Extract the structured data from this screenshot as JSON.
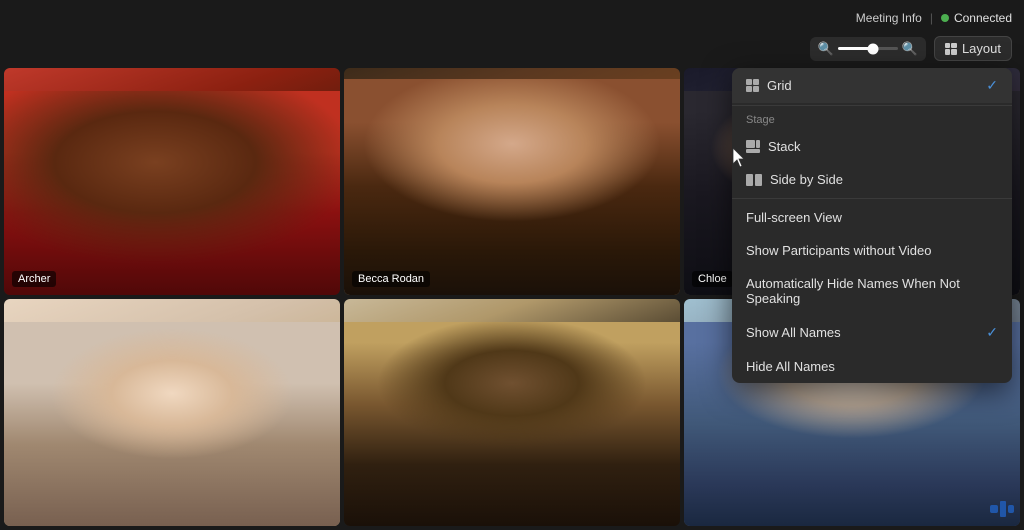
{
  "topbar": {
    "meeting_info_label": "Meeting Info",
    "separator": "|",
    "connected_label": "Connected"
  },
  "controls": {
    "zoom_minus": "⊖",
    "zoom_plus": "⊕",
    "layout_label": "Layout"
  },
  "dropdown": {
    "grid_label": "Grid",
    "stage_section": "Stage",
    "stack_label": "Stack",
    "side_by_side_label": "Side by Side",
    "fullscreen_label": "Full-screen View",
    "show_no_video_label": "Show Participants without Video",
    "auto_hide_names_label": "Automatically Hide Names When Not Speaking",
    "show_all_names_label": "Show All Names",
    "hide_all_names_label": "Hide All Names"
  },
  "participants": [
    {
      "name": "Archer",
      "position": "bottom-left"
    },
    {
      "name": "Becca Rodan",
      "position": "bottom-left"
    },
    {
      "name": "Chloe",
      "position": "bottom-left"
    },
    {
      "name": "",
      "position": "bottom-left"
    },
    {
      "name": "",
      "position": "bottom-left"
    },
    {
      "name": "",
      "position": "bottom-left"
    }
  ]
}
